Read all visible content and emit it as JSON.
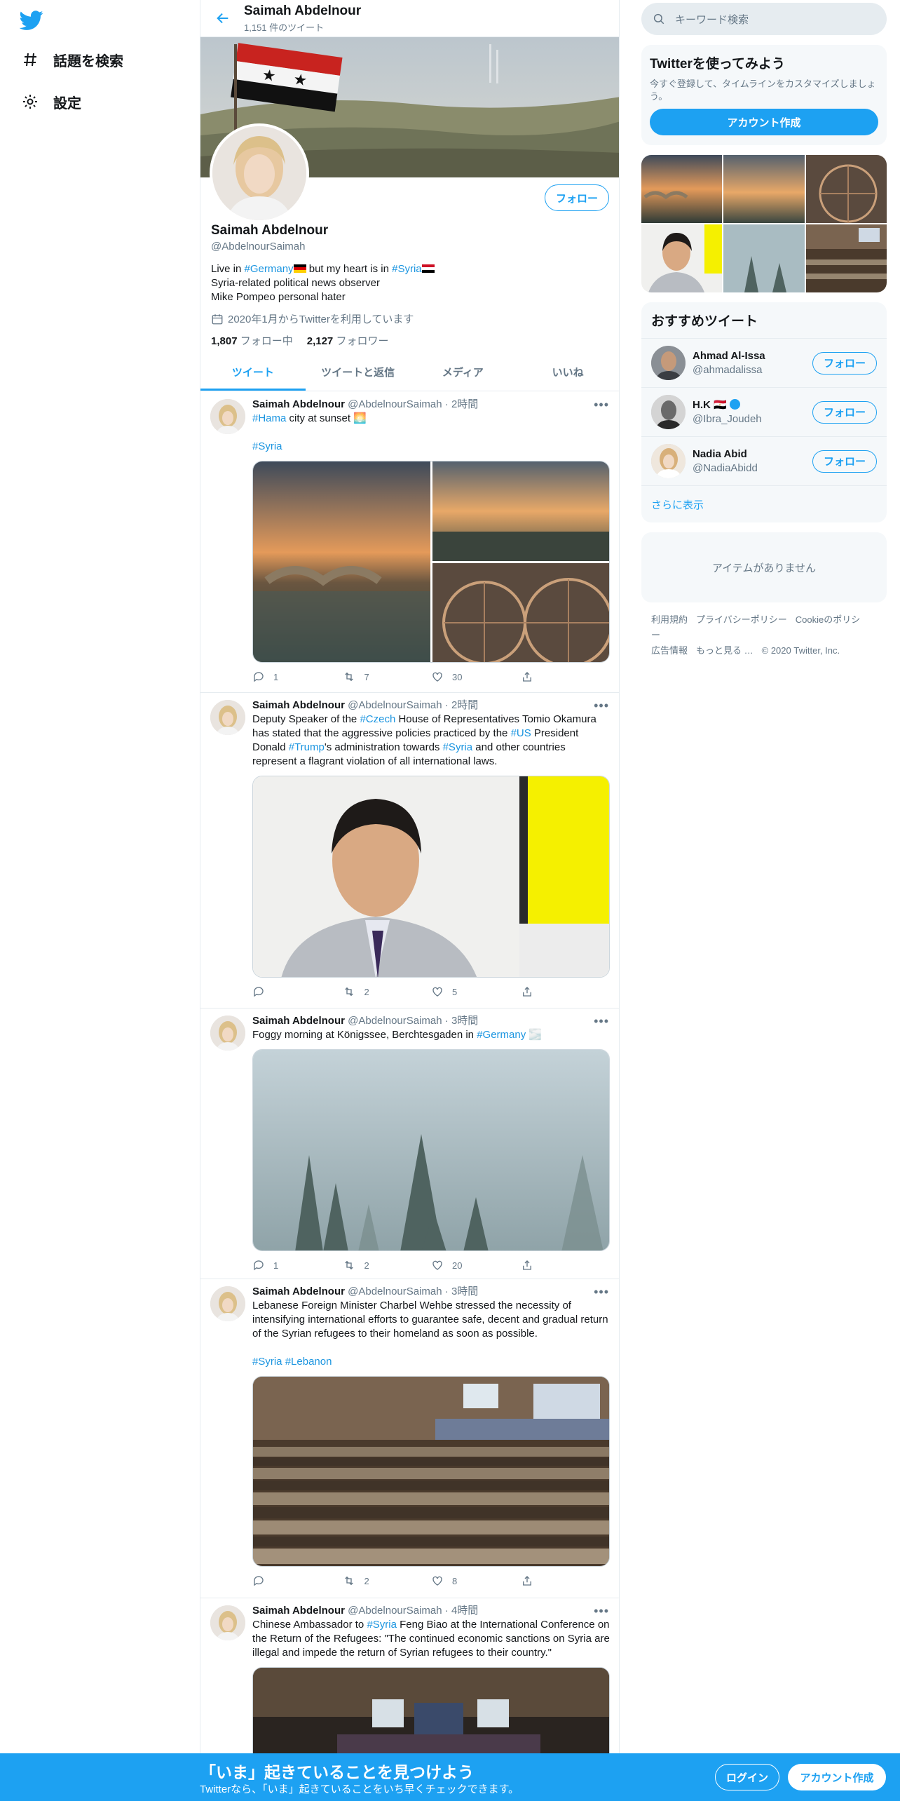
{
  "nav": {
    "logo": "twitter-bird-icon",
    "items": [
      {
        "label": "話題を検索",
        "icon": "hashtag-icon"
      },
      {
        "label": "設定",
        "icon": "gear-icon"
      }
    ]
  },
  "header": {
    "name": "Saimah Abdelnour",
    "tweet_count": "1,151 件のツイート"
  },
  "profile": {
    "name": "Saimah Abdelnour",
    "handle": "@AbdelnourSaimah",
    "follow_label": "フォロー",
    "bio": {
      "line1_a": "Live in ",
      "line1_tag1": "#Germany",
      "line1_b": " but my heart is in ",
      "line1_tag2": "#Syria",
      "line2": "Syria-related political news observer",
      "line3": "Mike Pompeo personal hater"
    },
    "joined": "2020年1月からTwitterを利用しています",
    "following_count": "1,807",
    "following_label": "フォロー中",
    "followers_count": "2,127",
    "followers_label": "フォロワー"
  },
  "tabs": [
    "ツイート",
    "ツイートと返信",
    "メディア",
    "いいね"
  ],
  "tweets": [
    {
      "name": "Saimah Abdelnour",
      "handle": "@AbdelnourSaimah",
      "time": "2時間",
      "text_a": "",
      "tag1": "#Hama",
      "text_b": " city at sunset 🌅",
      "tags_line": "#Syria",
      "replies": "1",
      "retweets": "7",
      "likes": "30"
    },
    {
      "name": "Saimah Abdelnour",
      "handle": "@AbdelnourSaimah",
      "time": "2時間",
      "p1": "Deputy Speaker of the ",
      "tag1": "#Czech",
      "p2": " House of Representatives Tomio Okamura has stated that the aggressive policies practiced by the ",
      "tag2": "#US",
      "p3": " President Donald ",
      "tag3": "#Trump",
      "p4": "'s administration towards ",
      "tag4": "#Syria",
      "p5": " and other countries represent a flagrant violation of all international laws.",
      "replies": "",
      "retweets": "2",
      "likes": "5"
    },
    {
      "name": "Saimah Abdelnour",
      "handle": "@AbdelnourSaimah",
      "time": "3時間",
      "p1": "Foggy morning at Königssee, Berchtesgaden in ",
      "tag1": "#Germany",
      "p2": " 🌫️",
      "replies": "1",
      "retweets": "2",
      "likes": "20"
    },
    {
      "name": "Saimah Abdelnour",
      "handle": "@AbdelnourSaimah",
      "time": "3時間",
      "p1": "Lebanese Foreign Minister Charbel Wehbe stressed the necessity of intensifying international efforts to guarantee safe, decent and gradual return of the Syrian refugees to their homeland as soon as possible.",
      "tag1": "#Syria",
      "tag2": "#Lebanon",
      "replies": "",
      "retweets": "2",
      "likes": "8"
    },
    {
      "name": "Saimah Abdelnour",
      "handle": "@AbdelnourSaimah",
      "time": "4時間",
      "p1": "Chinese Ambassador to ",
      "tag1": "#Syria",
      "p2": " Feng Biao at the International Conference on the Return of the Refugees: \"The continued economic sanctions on Syria are illegal and impede the return of Syrian refugees to their country.\""
    }
  ],
  "right": {
    "search_placeholder": "キーワード検索",
    "signup_title": "Twitterを使ってみよう",
    "signup_text": "今すぐ登録して、タイムラインをカスタマイズしましょう。",
    "signup_button": "アカウント作成",
    "rec_title": "おすすめツイート",
    "recs": [
      {
        "name": "Ahmad Al-Issa",
        "handle": "@ahmadalissa",
        "button": "フォロー"
      },
      {
        "name": "H.K 🇪🇬",
        "handle": "@Ibra_Joudeh",
        "button": "フォロー"
      },
      {
        "name": "Nadia Abid",
        "handle": "@NadiaAbidd",
        "button": "フォロー"
      }
    ],
    "show_more": "さらに表示",
    "empty_text": "アイテムがありません",
    "footer": [
      "利用規約",
      "プライバシーポリシー",
      "Cookieのポリシー",
      "広告情報",
      "もっと見る …",
      "© 2020 Twitter, Inc."
    ]
  },
  "bottom": {
    "title": "「いま」起きていることを見つけよう",
    "subtitle": "Twitterなら、「いま」起きていることをいち早くチェックできます。",
    "login": "ログイン",
    "signup": "アカウント作成"
  },
  "colors": {
    "accent": "#1da1f2",
    "text": "#14171a",
    "muted": "#657786"
  }
}
